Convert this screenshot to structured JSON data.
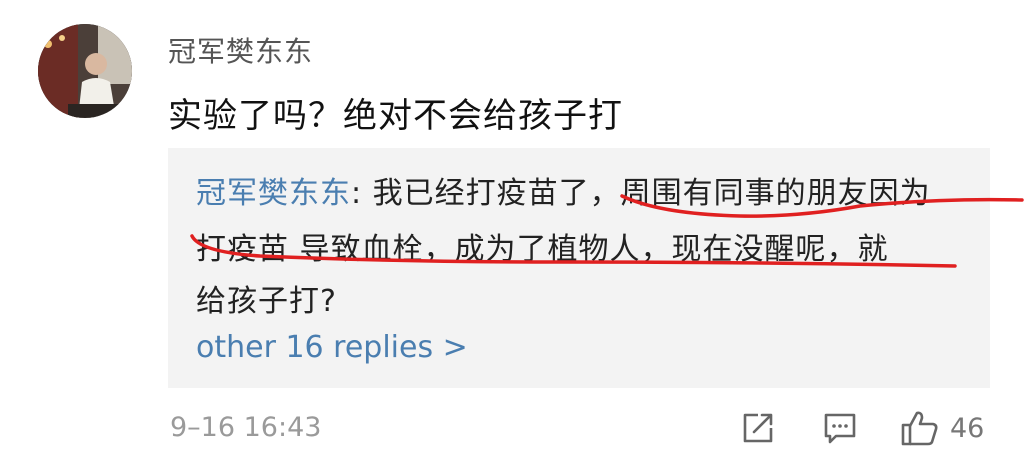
{
  "comment": {
    "author": "冠军樊东东",
    "text": "实验了吗？绝对不会给孩子打",
    "timestamp": "9–16 16:43",
    "like_count": "46"
  },
  "reply": {
    "author": "冠军樊东东",
    "separator": ": ",
    "line1": "我已经打疫苗了，周围有同事的朋友因为",
    "line2": "打疫苗 导致血栓，成为了植物人，现在没醒呢，就",
    "line3": "给孩子打?",
    "more_link": "other 16 replies >"
  },
  "icons": {
    "share": "share-icon",
    "comment": "comment-icon",
    "like": "thumbs-up-icon"
  },
  "colors": {
    "link_blue": "#4a7eb0",
    "annotation_red": "#e02020",
    "reply_bg": "#f3f3f3"
  }
}
